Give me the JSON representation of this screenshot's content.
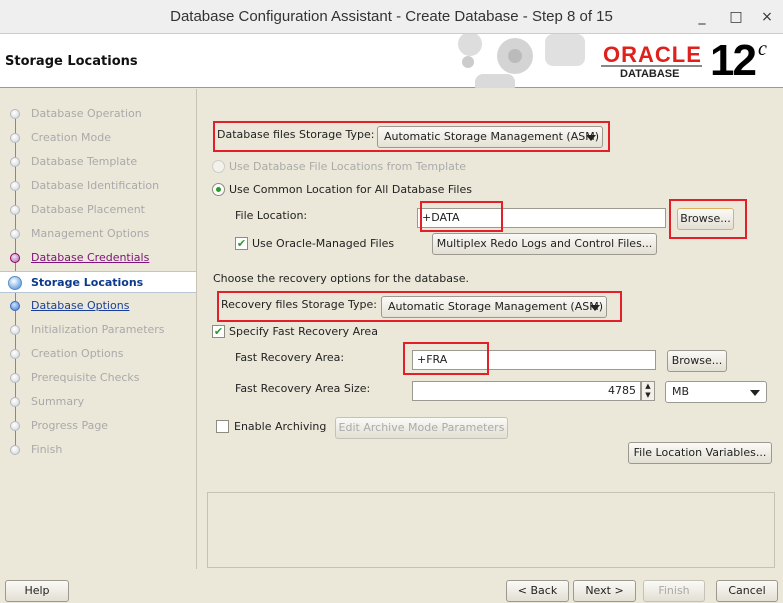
{
  "window": {
    "title": "Database Configuration Assistant - Create Database - Step 8 of 15",
    "minimize": "_",
    "maximize": "□",
    "close": "×"
  },
  "header": {
    "title": "Storage Locations",
    "logo_oracle": "ORACLE",
    "logo_database": "DATABASE",
    "logo_version": "12",
    "logo_suffix": "c"
  },
  "sidebar": {
    "steps": [
      {
        "label": "Database Operation",
        "state": "done"
      },
      {
        "label": "Creation Mode",
        "state": "done"
      },
      {
        "label": "Database Template",
        "state": "done"
      },
      {
        "label": "Database Identification",
        "state": "done"
      },
      {
        "label": "Database Placement",
        "state": "done"
      },
      {
        "label": "Management Options",
        "state": "done"
      },
      {
        "label": "Database Credentials",
        "state": "visited"
      },
      {
        "label": "Storage Locations",
        "state": "current"
      },
      {
        "label": "Database Options",
        "state": "next"
      },
      {
        "label": "Initialization Parameters",
        "state": "pending"
      },
      {
        "label": "Creation Options",
        "state": "pending"
      },
      {
        "label": "Prerequisite Checks",
        "state": "pending"
      },
      {
        "label": "Summary",
        "state": "pending"
      },
      {
        "label": "Progress Page",
        "state": "pending"
      },
      {
        "label": "Finish",
        "state": "pending"
      }
    ]
  },
  "main": {
    "db_storage_label": "Database files Storage Type:",
    "db_storage_value": "Automatic Storage Management (ASM)",
    "radio_template": "Use Database File Locations from Template",
    "radio_common": "Use Common Location for All Database Files",
    "file_location_label": "File Location:",
    "file_location_value": "+DATA",
    "browse1": "Browse...",
    "omf_label": "Use Oracle-Managed Files",
    "multiplex_button": "Multiplex Redo Logs and Control Files...",
    "recovery_intro": "Choose the recovery options for the database.",
    "recovery_storage_label": "Recovery files Storage Type:",
    "recovery_storage_value": "Automatic Storage Management (ASM)",
    "fra_checkbox": "Specify Fast Recovery Area",
    "fra_label": "Fast Recovery Area:",
    "fra_value": "+FRA",
    "browse2": "Browse...",
    "fra_size_label": "Fast Recovery Area Size:",
    "fra_size_value": "4785",
    "fra_unit": "MB",
    "archiving_label": "Enable Archiving",
    "archive_params_button": "Edit Archive Mode Parameters",
    "file_loc_vars_button": "File Location Variables..."
  },
  "footer": {
    "help": "Help",
    "back": "< Back",
    "next": "Next >",
    "finish": "Finish",
    "cancel": "Cancel"
  }
}
